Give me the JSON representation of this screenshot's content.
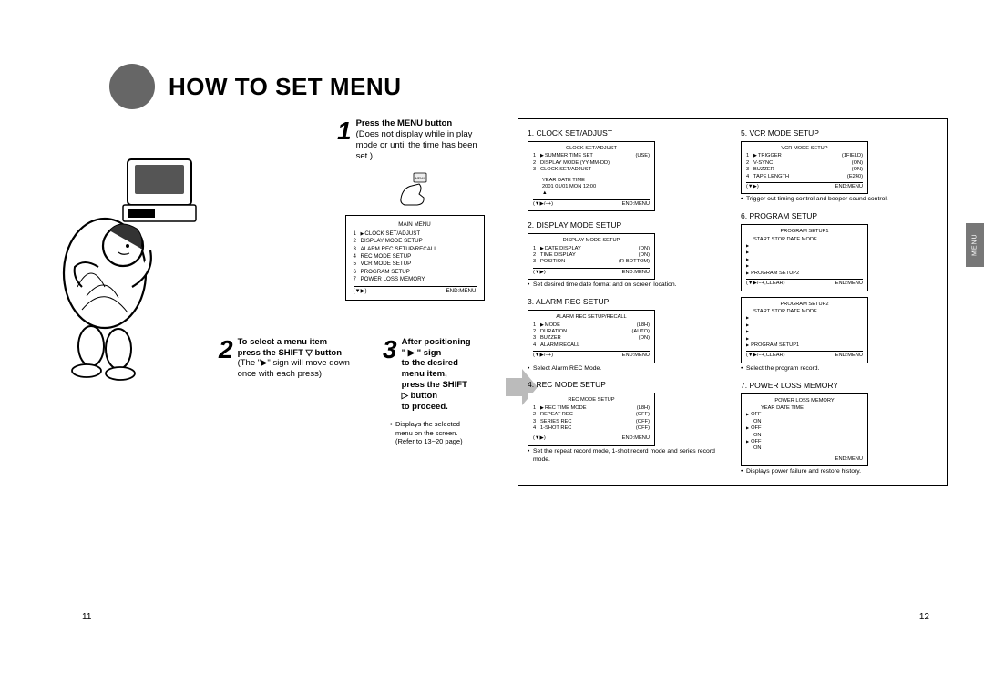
{
  "title": "HOW TO SET MENU",
  "side_tab": "MENU",
  "page_left": "11",
  "page_right": "12",
  "step1": {
    "heading": "Press the MENU button",
    "note": "(Does not display while in play mode or until the time has been set.)"
  },
  "main_menu": {
    "title": "MAIN MENU",
    "items": [
      "CLOCK SET/ADJUST",
      "DISPLAY MODE SETUP",
      "ALARM REC SETUP/RECALL",
      "REC MODE SETUP",
      "VCR MODE SETUP",
      "PROGRAM SETUP",
      "POWER LOSS MEMORY"
    ],
    "foot_left": "(▼▶)",
    "foot_right": "END:MENU"
  },
  "step2": {
    "heading_a": "To select a menu item",
    "heading_b": "press the SHIFT ▽ button",
    "note": "(The \"▶\" sign will move down once with each press)"
  },
  "step3": {
    "heading_a": "After positioning \" ▶ \" sign",
    "heading_b": "to the desired menu item,",
    "heading_c": "press the SHIFT ▷ button",
    "heading_d": "to proceed.",
    "bullet": "Displays the selected menu on the screen. (Refer to 13~20 page)"
  },
  "sections": {
    "s1": {
      "title": "1. CLOCK SET/ADJUST",
      "osd_title": "CLOCK SET/ADJUST",
      "rows": [
        [
          "1",
          "SUMMER TIME SET",
          "(USE)"
        ],
        [
          "2",
          "DISPLAY MODE (YY-MM-DD)",
          ""
        ],
        [
          "3",
          "CLOCK SET/ADJUST",
          ""
        ]
      ],
      "extra1": "YEAR    DATE          TIME",
      "extra2": "2001     01/01 MON    12:00",
      "foot_left": "(▼▶/−+)",
      "foot_right": "END:MENU"
    },
    "s2": {
      "title": "2. DISPLAY MODE SETUP",
      "osd_title": "DISPLAY MODE SETUP",
      "rows": [
        [
          "1",
          "DATE DISPLAY",
          "(ON)"
        ],
        [
          "2",
          "TIME DISPLAY",
          "(ON)"
        ],
        [
          "3",
          "POSITION",
          "(R-BOTTOM)"
        ]
      ],
      "foot_left": "(▼▶)",
      "foot_right": "END:MENU",
      "note": "Set desired time date format and on screen location."
    },
    "s3": {
      "title": "3. ALARM REC SETUP",
      "osd_title": "ALARM REC SETUP/RECALL",
      "rows": [
        [
          "1",
          "MODE",
          "(L8H)"
        ],
        [
          "2",
          "DURATION",
          "(AUTO)"
        ],
        [
          "3",
          "BUZZER",
          "(ON)"
        ],
        [
          "4",
          "ALARM RECALL",
          ""
        ]
      ],
      "foot_left": "(▼▶/−+)",
      "foot_right": "END:MENU",
      "note": "Select Alarm REC Mode."
    },
    "s4": {
      "title": "4. REC MODE SETUP",
      "osd_title": "REC MODE SETUP",
      "rows": [
        [
          "1",
          "REC TIME MODE",
          "(L8H)"
        ],
        [
          "2",
          "REPEAT REC",
          "(OFF)"
        ],
        [
          "3",
          "SERIES REC",
          "(OFF)"
        ],
        [
          "4",
          "1-SHOT REC",
          "(OFF)"
        ]
      ],
      "foot_left": "(▼▶)",
      "foot_right": "END:MENU",
      "note": "Set the repeat record mode, 1-shot record mode and series record mode."
    },
    "s5": {
      "title": "5. VCR MODE SETUP",
      "osd_title": "VCR MODE SETUP",
      "rows": [
        [
          "1",
          "TRIGGER",
          "(1FIELD)"
        ],
        [
          "2",
          "V-SYNC",
          "(ON)"
        ],
        [
          "3",
          "BUZZER",
          "(ON)"
        ],
        [
          "4",
          "TAPE LENGTH",
          "(E240)"
        ]
      ],
      "foot_left": "(▼▶)",
      "foot_right": "END:MENU",
      "note": "Trigger out timing control and beeper sound control."
    },
    "s6": {
      "title": "6. PROGRAM SETUP",
      "osd_title1": "PROGRAM SETUP1",
      "hdr": "START   STOP    DATE       MODE",
      "link1": "PROGRAM SETUP2",
      "foot_left": "(▼▶/−+,CLEAR)",
      "foot_right": "END:MENU",
      "osd_title2": "PROGRAM SETUP2",
      "link2": "PROGRAM SETUP1",
      "note": "Select the program record."
    },
    "s7": {
      "title": "7. POWER LOSS MEMORY",
      "osd_title": "POWER LOSS MEMORY",
      "hdr": "YEAR   DATE   TIME",
      "lines": [
        "OFF",
        "ON",
        "OFF",
        "ON",
        "OFF",
        "ON"
      ],
      "foot_right": "END:MENU",
      "note": "Displays power failure and restore history."
    }
  }
}
